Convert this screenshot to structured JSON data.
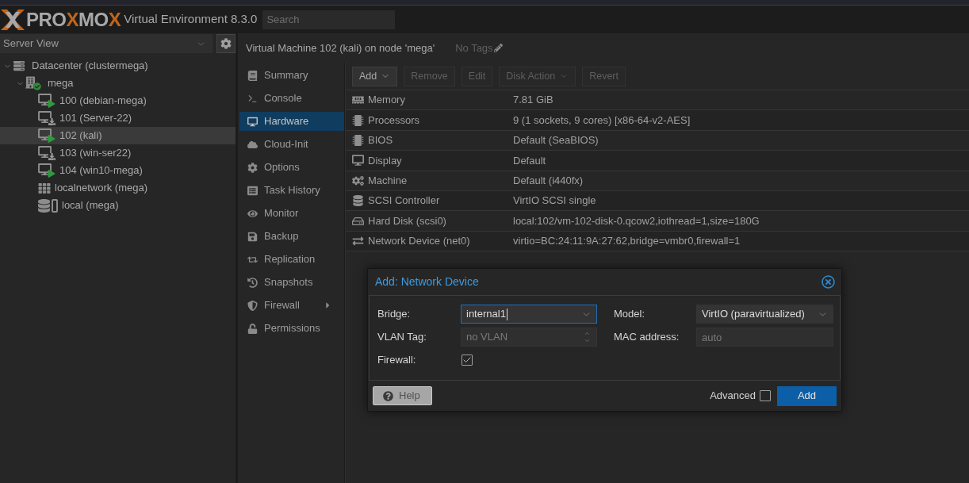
{
  "top_bar": {
    "logo": {
      "parts": [
        {
          "text": "PRO",
          "accent": false
        },
        {
          "text": "X",
          "accent": true
        },
        {
          "text": "MO",
          "accent": false
        },
        {
          "text": "X",
          "accent": true
        }
      ]
    },
    "product": "Virtual Environment 8.3.0",
    "search": {
      "placeholder": "Search"
    }
  },
  "sidebar": {
    "view_select": {
      "value": "Server View"
    },
    "tree": [
      {
        "label": "Datacenter (clustermega)",
        "kind": "datacenter",
        "expanded": true,
        "selected": false,
        "children": [
          {
            "label": "mega",
            "kind": "node",
            "check_badge": true,
            "expanded": true,
            "selected": false,
            "children": [
              {
                "label": "100 (debian-mega)",
                "kind": "vm",
                "play_badge": true,
                "selected": false
              },
              {
                "label": "101 (Server-22)",
                "kind": "vm",
                "play_badge": false,
                "selected": false
              },
              {
                "label": "102 (kali)",
                "kind": "vm",
                "play_badge": true,
                "selected": true
              },
              {
                "label": "103 (win-ser22)",
                "kind": "vm",
                "play_badge": false,
                "selected": false
              },
              {
                "label": "104 (win10-mega)",
                "kind": "vm",
                "play_badge": true,
                "selected": false
              },
              {
                "label": "localnetwork (mega)",
                "kind": "network",
                "selected": false
              },
              {
                "label": "local (mega)",
                "kind": "storage",
                "selected": false
              }
            ]
          }
        ]
      }
    ]
  },
  "vm_header": {
    "title": "Virtual Machine 102 (kali) on node 'mega'",
    "tags": "No Tags"
  },
  "nav": {
    "items": [
      {
        "label": "Summary",
        "selected": false,
        "submenu": false
      },
      {
        "label": "Console",
        "selected": false,
        "submenu": false
      },
      {
        "label": "Hardware",
        "selected": true,
        "submenu": false
      },
      {
        "label": "Cloud-Init",
        "selected": false,
        "submenu": false
      },
      {
        "label": "Options",
        "selected": false,
        "submenu": false
      },
      {
        "label": "Task History",
        "selected": false,
        "submenu": false
      },
      {
        "label": "Monitor",
        "selected": false,
        "submenu": false
      },
      {
        "label": "Backup",
        "selected": false,
        "submenu": false
      },
      {
        "label": "Replication",
        "selected": false,
        "submenu": false
      },
      {
        "label": "Snapshots",
        "selected": false,
        "submenu": false
      },
      {
        "label": "Firewall",
        "selected": false,
        "submenu": true
      },
      {
        "label": "Permissions",
        "selected": false,
        "submenu": false
      }
    ]
  },
  "toolbar": {
    "buttons": [
      {
        "label": "Add",
        "disabled": false,
        "menu": true
      },
      {
        "label": "Remove",
        "disabled": true,
        "menu": false
      },
      {
        "label": "Edit",
        "disabled": true,
        "menu": false
      },
      {
        "label": "Disk Action",
        "disabled": true,
        "menu": true
      },
      {
        "label": "Revert",
        "disabled": true,
        "menu": false
      }
    ]
  },
  "hardware": {
    "rows": [
      {
        "name": "Memory",
        "value": "7.81 GiB"
      },
      {
        "name": "Processors",
        "value": "9 (1 sockets, 9 cores) [x86-64-v2-AES]"
      },
      {
        "name": "BIOS",
        "value": "Default (SeaBIOS)"
      },
      {
        "name": "Display",
        "value": "Default"
      },
      {
        "name": "Machine",
        "value": "Default (i440fx)"
      },
      {
        "name": "SCSI Controller",
        "value": "VirtIO SCSI single"
      },
      {
        "name": "Hard Disk (scsi0)",
        "value": "local:102/vm-102-disk-0.qcow2,iothread=1,size=180G"
      },
      {
        "name": "Network Device (net0)",
        "value": "virtio=BC:24:11:9A:27:62,bridge=vmbr0,firewall=1"
      }
    ]
  },
  "dialog": {
    "title": "Add: Network Device",
    "left_fields": [
      {
        "label": "Bridge:",
        "kind": "combo",
        "value": "internal1",
        "focused": true
      },
      {
        "label": "VLAN Tag:",
        "kind": "spinner",
        "placeholder": "no VLAN",
        "focused": false
      },
      {
        "label": "Firewall:",
        "kind": "checkbox",
        "checked": true
      }
    ],
    "right_fields": [
      {
        "label": "Model:",
        "kind": "combo",
        "value": "VirtIO (paravirtualized)",
        "focused": false
      },
      {
        "label": "MAC address:",
        "kind": "text",
        "placeholder": "auto",
        "focused": false
      }
    ],
    "help_button": "Help",
    "advanced": {
      "label": "Advanced",
      "checked": false
    },
    "submit_button": "Add"
  }
}
